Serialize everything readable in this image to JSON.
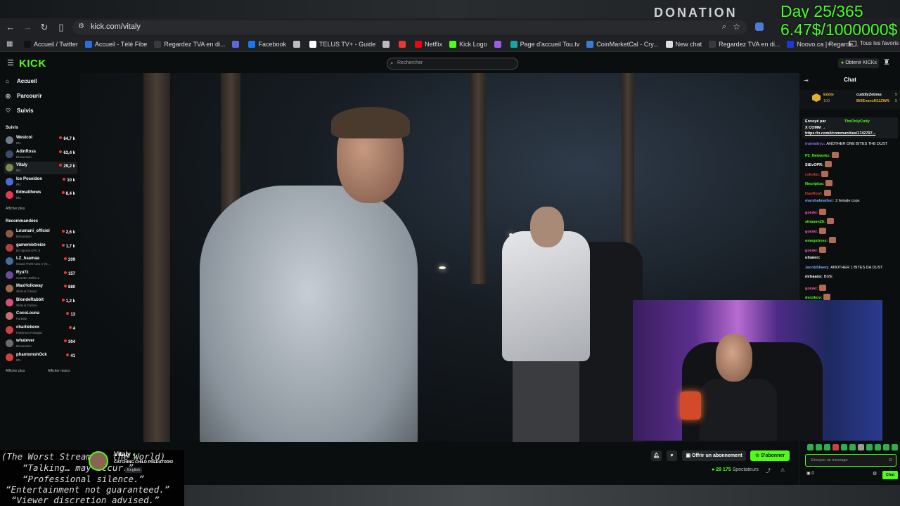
{
  "overlay": {
    "donation_label": "DONATION",
    "day_counter": "Day 25/365",
    "goal_counter": "6.47$/1000000$",
    "quotes": [
      "(The Worst Stream in the World)",
      "“Talking… may occur.”",
      "“Professional silence.”",
      "“Entertainment not guaranteed.”",
      "“Viewer discretion advised.”"
    ]
  },
  "browser": {
    "url": "kick.com/vitaly",
    "bookmarks": [
      {
        "label": "Accueil / Twitter",
        "color": "#111111"
      },
      {
        "label": "Accueil - Télé Fibe",
        "color": "#2a6fdb"
      },
      {
        "label": "Regardez TVA en di...",
        "color": "#3a3a3a"
      },
      {
        "label": "",
        "color": "#5a6ad8"
      },
      {
        "label": "Facebook",
        "color": "#1877f2"
      },
      {
        "label": "",
        "color": "#bbbbbb"
      },
      {
        "label": "TELUS TV+ - Guide",
        "color": "#ffffff"
      },
      {
        "label": "",
        "color": "#bbbbbb"
      },
      {
        "label": "",
        "color": "#e53935"
      },
      {
        "label": "Netflix",
        "color": "#e50914"
      },
      {
        "label": "Kick Logo",
        "color": "#53fc18"
      },
      {
        "label": "",
        "color": "#9b5de5"
      },
      {
        "label": "Page d'accueil Tou.tv",
        "color": "#1aa3a3"
      },
      {
        "label": "CoinMarketCal - Cry...",
        "color": "#3a7bd5"
      },
      {
        "label": "New chat",
        "color": "#dddddd"
      },
      {
        "label": "Regardez TVA en di...",
        "color": "#3a3a3a"
      },
      {
        "label": "Noovo.ca | Regarde...",
        "color": "#1a3ad5"
      }
    ],
    "all_bookmarks": "Tous les favoris"
  },
  "kick": {
    "logo": "KICK",
    "search_placeholder": "Rechercher",
    "get_kicks": "Obtenir KICKs",
    "nav": [
      {
        "label": "Accueil",
        "icon": "home-icon"
      },
      {
        "label": "Parcourir",
        "icon": "compass-icon"
      },
      {
        "label": "Suivis",
        "icon": "heart-icon"
      }
    ],
    "following_title": "Suivis",
    "following": [
      {
        "name": "Westcol",
        "cat": "IRL",
        "count": "64,7 k",
        "color": "#6b7b8c"
      },
      {
        "name": "AdinRoss",
        "cat": "Discussion",
        "count": "63,4 k",
        "color": "#3a4b6b"
      },
      {
        "name": "Vitaly",
        "cat": "IRL",
        "count": "29,2 k",
        "color": "#7a8a4a"
      },
      {
        "name": "Ice Poseidon",
        "cat": "IRL",
        "count": "10 k",
        "color": "#4a6bd8"
      },
      {
        "name": "Edmatthews",
        "cat": "IRL",
        "count": "8,4 k",
        "color": "#e53950"
      }
    ],
    "show_more": "Afficher plus",
    "recommended_title": "Recommandées",
    "recommended": [
      {
        "name": "Loumani_officiel",
        "cat": "Discussion",
        "count": "2,6 k",
        "color": "#8a5a4a"
      },
      {
        "name": "gamemixtreize",
        "cat": "EA Sports UFC 5",
        "count": "1,7 k",
        "color": "#b04040"
      },
      {
        "name": "LZ_haamaa",
        "cat": "Grand Theft Auto V (G...",
        "count": "209",
        "color": "#4a6a9a"
      },
      {
        "name": "Ryu7z",
        "cat": "Counter-Strike 2",
        "count": "157",
        "color": "#6a4a9a"
      },
      {
        "name": "MaxHolloway",
        "cat": "Slots & Casino",
        "count": "880",
        "color": "#9a6a4a"
      },
      {
        "name": "BlondeRabbit",
        "cat": "Slots & Casino",
        "count": "1,2 k",
        "color": "#d35080"
      },
      {
        "name": "CocoLouna",
        "cat": "Fortnite",
        "count": "13",
        "color": "#c07070"
      },
      {
        "name": "charliebexx",
        "cat": "Pokemon Pokopia",
        "count": "4",
        "color": "#d04040"
      },
      {
        "name": "whatever",
        "cat": "Discussion",
        "count": "304",
        "color": "#6a6a6a"
      },
      {
        "name": "phantomshOck",
        "cat": "IRL",
        "count": "41",
        "color": "#d04040"
      }
    ],
    "show_more_2": "Afficher plus",
    "show_less": "Afficher moins",
    "streamer": {
      "name": "Vitaly",
      "title": "CATCHING CHILD PREDATORS!",
      "language": "English",
      "viewers": "29 175",
      "viewers_label": "Spectateurs"
    },
    "subscribe_label": "Offrir un abonnement",
    "follow_label": "S'abonner",
    "chat": {
      "title": "Chat",
      "gifters": [
        {
          "name": "Eddie",
          "sub": "100",
          "color": "#e0b030"
        },
        {
          "name": "cuddlyZebras",
          "sub": "5",
          "color": "#ffffff"
        },
        {
          "name": "BillEvansN112WN",
          "sub": "5",
          "color": "#e0b030"
        }
      ],
      "pinned_by": "Envoyé par",
      "pinned_user": "TheOnlyCody",
      "pinned_line1": "X COMM →",
      "pinned_line2": "https://x.com/i/communities/1742797...",
      "messages": [
        {
          "user": "trainattryz:",
          "text": "ANOTHER ONE BITES THE DUST",
          "color": "#9b6bff",
          "emote": false
        },
        {
          "user": "P2_Networkz:",
          "text": "",
          "color": "#53fc18",
          "emote": true
        },
        {
          "user": "StEvOPR:",
          "text": "",
          "color": "#ffffff",
          "emote": true
        },
        {
          "user": "roforlio:",
          "text": "",
          "color": "#e53935",
          "emote": true
        },
        {
          "user": "Necriptos:",
          "text": "",
          "color": "#53fc18",
          "emote": true
        },
        {
          "user": "DaoRoof:",
          "text": "",
          "color": "#e53935",
          "emote": true
        },
        {
          "user": "marshalmather:",
          "text": "2 female cops",
          "color": "#7aa7ff",
          "emote": false
        },
        {
          "user": "gorski:",
          "text": "",
          "color": "#ff5bbd",
          "emote": true
        },
        {
          "user": "shiamm2lt:",
          "text": "",
          "color": "#53fc18",
          "emote": true
        },
        {
          "user": "gorski:",
          "text": "",
          "color": "#ff5bbd",
          "emote": true
        },
        {
          "user": "omegstreez:",
          "text": "",
          "color": "#53fc18",
          "emote": true
        },
        {
          "user": "gorski:",
          "text": "",
          "color": "#ff5bbd",
          "emote": true
        },
        {
          "user": "ufoalen:",
          "text": "",
          "color": "#ffffff",
          "emote": false
        },
        {
          "user": "JacobShaeq:",
          "text": "ANOTHER 1 BITES DA DUST",
          "color": "#7aa7ff",
          "emote": false
        },
        {
          "user": "mrbaans:",
          "text": "BIZE",
          "color": "#ffffff",
          "emote": false
        },
        {
          "user": "gorski:",
          "text": "",
          "color": "#ff5bbd",
          "emote": true
        },
        {
          "user": "derzikov:",
          "text": "",
          "color": "#53fc18",
          "emote": true
        }
      ],
      "input_placeholder": "Envoyer un message",
      "send_label": "Chat",
      "kicks_balance": "0"
    }
  }
}
